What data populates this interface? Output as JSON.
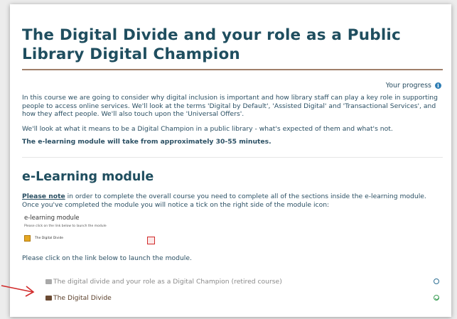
{
  "page": {
    "title": "The Digital Divide and your role as a Public Library Digital Champion",
    "progress_label": "Your progress",
    "intro_paragraphs": [
      "In this course we are going to consider why digital inclusion is important and how library staff can play a key role in supporting people to access online services. We'll look at the terms 'Digital by Default', 'Assisted Digital' and 'Transactional Services', and how they affect people. We'll also touch upon the 'Universal Offers'.",
      "We'll look at what it means to be a Digital Champion in a public library - what's expected of them and what's not.",
      "The e-learning module will take from approximately 30-55 minutes."
    ]
  },
  "section": {
    "heading": "e-Learning module",
    "note_label": "Please note",
    "note_text": " in order to complete the overall course you need to complete all of the sections inside the e-learning module.  Once you've completed the module you will notice a tick on the right side of the module icon:",
    "embed_title": "e-learning module",
    "embed_instruction": "Please click on the link below to launch the module",
    "embed_link": "The Digital Divide",
    "launch_text": "Please click on the link below to launch the module."
  },
  "modules": [
    {
      "label": "The digital divide and your role as a Digital Champion (retired course)",
      "status": "not-complete",
      "color": "#8a8a8a"
    },
    {
      "label": "The Digital Divide",
      "status": "complete",
      "color": "#5a3f2a"
    }
  ],
  "colors": {
    "heading": "#1f4e5f",
    "body_text": "#2a4f63",
    "rule": "#a07f6a",
    "complete": "#3d9f58",
    "arrow": "#d12a2a"
  }
}
